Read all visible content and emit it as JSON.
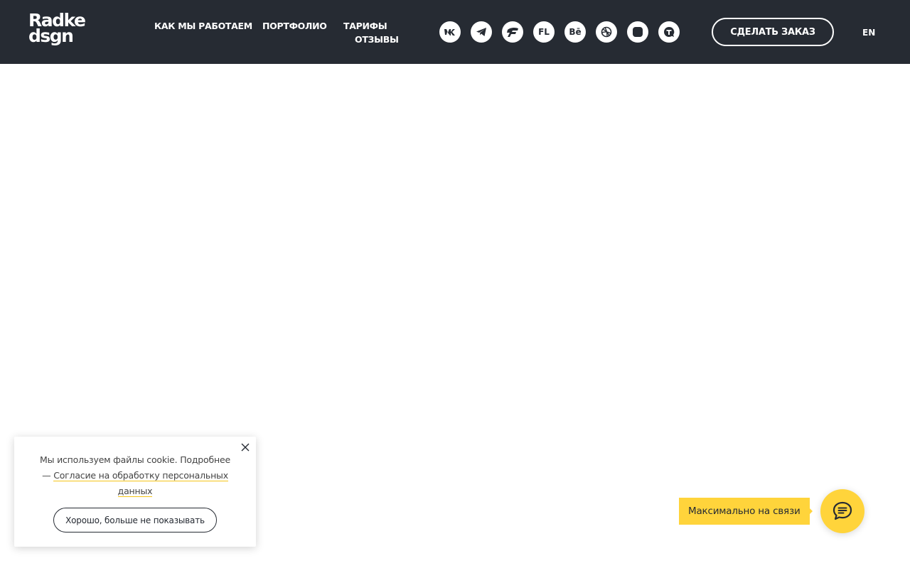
{
  "header": {
    "logo": {
      "line1": "Radke",
      "line2": "dsgn"
    },
    "nav": [
      {
        "label": "КАК МЫ РАБОТАЕМ"
      },
      {
        "label": "ПОРТФОЛИО"
      },
      {
        "label": "ТАРИФЫ"
      },
      {
        "label": "ОТЗЫВЫ"
      }
    ],
    "socials": [
      {
        "icon": "vk-icon",
        "label": ""
      },
      {
        "icon": "telegram-icon",
        "label": ""
      },
      {
        "icon": "freelancer-icon",
        "label": ""
      },
      {
        "icon": "fl-icon",
        "label": "FL"
      },
      {
        "icon": "behance-icon",
        "label": "Bē"
      },
      {
        "icon": "dribbble-icon",
        "label": ""
      },
      {
        "icon": "instagram-icon",
        "label": ""
      },
      {
        "icon": "tiktok-chat-icon",
        "label": ""
      }
    ],
    "order_button": "СДЕЛАТЬ ЗАКАЗ",
    "language": "EN"
  },
  "cookie_banner": {
    "text_before": "Мы используем файлы cookie. Подробнее —",
    "link_text": "Согласие на обработку персональных данных",
    "ok_button": "Хорошо, больше не показывать"
  },
  "chat_widget": {
    "label": "Максимально на связи",
    "icon": "chat-bubble-icon"
  },
  "colors": {
    "header_bg": "#262b33",
    "accent": "#ffd43b",
    "text_light": "#ffffff"
  }
}
